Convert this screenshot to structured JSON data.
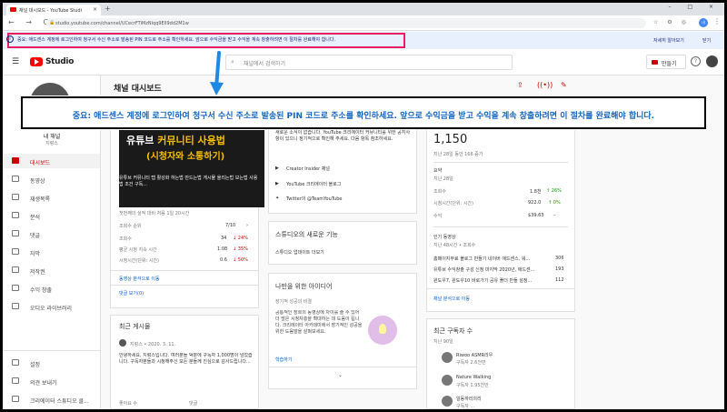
{
  "browser": {
    "tab_title": "채널 대시보드 - YouTube Studi",
    "tab_close": "×",
    "new_tab": "+",
    "window_controls": "– □ ×",
    "nav": "← → C",
    "url": "studio.youtube.com/channel/UCecrFTiMzNiqq9Ell9dd2M1w",
    "lock": "🔒",
    "ext_icons": "☆ ⚙ ◎",
    "profile_badge": "내",
    "menu_dots": "⋮"
  },
  "notice": {
    "icon": "i",
    "text": "중요: 애드센스 계정에 로그인하여 청구서 수신 주소로 발송된 PIN 코드로 주소를 확인하세요. 앞으로 수익금을 받고 수익을 계속 창출하려면 이 절차를 완료해야 합니다.",
    "learn_more": "자세히 알아보기",
    "dismiss": "닫기"
  },
  "header": {
    "menu": "☰",
    "logo_text": "Studio",
    "search_icon": "⌕",
    "search_placeholder": "채널에서 검색하기",
    "create_label": "만들기",
    "help": "?"
  },
  "sidebar": {
    "channel_label": "내 채널",
    "channel_name": "지렁스",
    "items": [
      {
        "label": "대시보드"
      },
      {
        "label": "동영상"
      },
      {
        "label": "재생목록"
      },
      {
        "label": "분석"
      },
      {
        "label": "댓글"
      },
      {
        "label": "자막"
      },
      {
        "label": "저작권"
      },
      {
        "label": "수익 창출"
      },
      {
        "label": "오디오 라이브러리"
      }
    ],
    "bottom_items": [
      {
        "label": "설정"
      },
      {
        "label": "의견 보내기"
      },
      {
        "label": "크리에이터 스튜디오 클..."
      }
    ]
  },
  "main": {
    "title": "채널 대시보드",
    "top_icons": [
      "⇪",
      "((•))",
      "✎"
    ]
  },
  "video_card": {
    "thumb_line1_a": "유튜브 ",
    "thumb_line1_b": "커뮤니티 사용법",
    "thumb_line2": "(시청자와 소통하기)",
    "caption": "유튜브 커뮤니티 탭 활성화 하는법 만드는법 게시물 올리는법 보는법 사용법 조건 구독...",
    "perf": "첫번째의 실적 대비 처음 1일 20시간",
    "rows": [
      {
        "label": "조회수 순위",
        "value": "7/10",
        "arrow": "›"
      },
      {
        "label": "조회수",
        "value": "34",
        "delta": "↓ 24%"
      },
      {
        "label": "평균 시청 지속 시간",
        "value": "1:08",
        "delta": "↓ 35%"
      },
      {
        "label": "시청시간(단위: 시간)",
        "value": "0.6",
        "delta": "↓ 50%"
      }
    ],
    "link1": "동영상 분석으로 이동",
    "link2": "댓글 보기(0)"
  },
  "news_card": {
    "text": "새로운 소식이 없습니다. YouTube 크리에이터 커뮤니티를 위한 공지사항이 있으니 정기적으로 확인해 주세요. 다음 항목 참조하세요.",
    "links": [
      "Creator Insider 채널",
      "YouTube 크리에이터 블로그",
      "Twitter의 @TeamYouTube"
    ]
  },
  "studio_card": {
    "title": "스튜디오의 새로운 기능",
    "text": "스튜디오 업데이트 더보기"
  },
  "ideas_card": {
    "title": "나만을 위한 아이디어",
    "subtitle": "장기적 성공의 비결",
    "text": "공통적인 장르의 동영상에 차이를 줄 수 있어 더 많은 시청자층을 확대하는 데 도움이 됩니다. 크리에이터 아카데미에서 장기적인 성공을 위한 도움말을 살펴보세요.",
    "link": "학습하기",
    "chevron": "⌄"
  },
  "posts_card": {
    "title": "최근 게시물",
    "author": "지렁스 • 2020. 3. 11.",
    "text": "안녕하세요, 지렁스입니다. 여러분들 덕분에 구독자 1,000명이 넘었습니다. 구독자분들과 시청해주신 모든 분들께 진심으로 감사드립니다...",
    "col1": "좋아요 수",
    "col2": "댓글"
  },
  "analytics_card": {
    "subs_value": "1,150",
    "subs_delta": "지난 28일 동안 166 증가",
    "summary_title": "요약",
    "summary_period": "지난 28일",
    "rows": [
      {
        "label": "조회수",
        "value": "1.8천",
        "delta": "↑ 26%"
      },
      {
        "label": "시청시간(단위: 시간)",
        "value": "922.0",
        "delta": "↑ 0%"
      },
      {
        "label": "수익",
        "value": "$39.63",
        "delta": "–"
      }
    ],
    "popular_title": "인기 동영상",
    "popular_period": "지난 48시간 • 조회수",
    "popular": [
      {
        "title": "홈페이지무료 블로그 만들기 네이버 애드센스, 워...",
        "value": "306"
      },
      {
        "title": "유튜브 수익창출 구성 신청 마지막 2020년, 애드센...",
        "value": "193"
      },
      {
        "title": "윈도우7, 윈도우10 바로가기 공유 폴더 만들 설정...",
        "value": "112"
      }
    ],
    "link": "채널 분석으로 이동"
  },
  "subs_card": {
    "title": "최근 구독자 수",
    "period": "지난 90일",
    "subs": [
      {
        "name": "Riwoo ASMR리우",
        "meta": "구독자 2.6천만"
      },
      {
        "name": "Nature Walking",
        "meta": "구독자 1.95천만"
      },
      {
        "name": "일동하리의리",
        "meta": "구독자 ..."
      }
    ]
  },
  "callout": {
    "text": "중요: 애드센스 계정에 로그인하여 청구서 수신 주소로 발송된 PIN 코드로 주소를 확인하세요. 앞으로 수익금을 받고 수익을 계속 창출하려면 이 절차를 완료해야 합니다."
  },
  "colors": {
    "accent": "#c00000",
    "link": "#065fd4",
    "notice_border": "#e91e63",
    "callout_text": "#1565c0",
    "arrow": "#1e88e5"
  }
}
